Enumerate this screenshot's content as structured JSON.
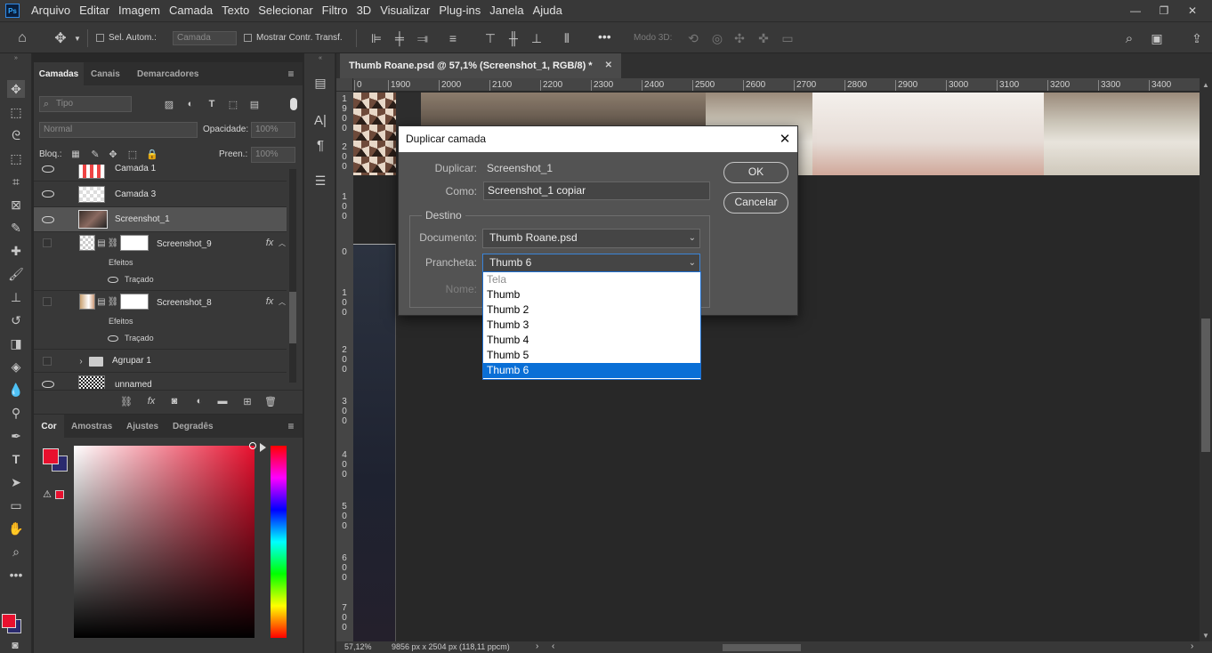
{
  "app": {
    "logo": "Ps"
  },
  "menu": [
    "Arquivo",
    "Editar",
    "Imagem",
    "Camada",
    "Texto",
    "Selecionar",
    "Filtro",
    "3D",
    "Visualizar",
    "Plug-ins",
    "Janela",
    "Ajuda"
  ],
  "window_controls": {
    "minimize": "—",
    "restore": "❐",
    "close": "✕"
  },
  "options": {
    "auto_select": "Sel. Autom.:",
    "auto_select_target": "Camada",
    "show_transform": "Mostrar Contr. Transf.",
    "more": "•••",
    "mode_3d": "Modo 3D:"
  },
  "layers_panel": {
    "tabs": [
      "Camadas",
      "Canais",
      "Demarcadores"
    ],
    "filter_placeholder": "Tipo",
    "blend_mode": "Normal",
    "opacity_label": "Opacidade:",
    "opacity": "100%",
    "lock_label": "Bloq.:",
    "fill_label": "Preen.:",
    "fill": "100%",
    "layers": [
      {
        "name": "Camada 1",
        "visible": true
      },
      {
        "name": "Camada 3",
        "visible": true
      },
      {
        "name": "Screenshot_1",
        "visible": true,
        "selected": true
      },
      {
        "name": "Screenshot_9",
        "visible": false,
        "effects": "Efeitos",
        "effect": "Traçado"
      },
      {
        "name": "Screenshot_8",
        "visible": false,
        "effects": "Efeitos",
        "effect": "Traçado"
      },
      {
        "name": "Agrupar 1",
        "visible": false,
        "group": true
      },
      {
        "name": "unnamed",
        "visible": true
      }
    ]
  },
  "color_panel": {
    "tabs": [
      "Cor",
      "Amostras",
      "Ajustes",
      "Degradês"
    ],
    "foreground": "#e8102e",
    "background": "#2a2a6e"
  },
  "document": {
    "tab_title": "Thumb Roane.psd @ 57,1% (Screenshot_1, RGB/8) *",
    "ruler_h": [
      "0",
      "1900",
      "2000",
      "2100",
      "2200",
      "2300",
      "2400",
      "2500",
      "2600",
      "2700",
      "2800",
      "2900",
      "3000",
      "3100",
      "3200",
      "3300",
      "3400"
    ],
    "ruler_v": [
      "1 9 0 0",
      "2 0 0",
      "1 0 0",
      "0",
      "1 0 0",
      "2 0 0",
      "3 0 0",
      "4 0 0",
      "5 0 0",
      "6 0 0",
      "7 0 0"
    ],
    "zoom": "57,12%",
    "doc_info": "9856 px x 2504 px (118,11 ppcm)"
  },
  "dialog": {
    "title": "Duplicar camada",
    "duplicate_label": "Duplicar:",
    "duplicate_value": "Screenshot_1",
    "as_label": "Como:",
    "as_value": "Screenshot_1 copiar",
    "destination_label": "Destino",
    "document_label": "Documento:",
    "document_value": "Thumb Roane.psd",
    "artboard_label": "Prancheta:",
    "artboard_value": "Thumb 6",
    "name_label": "Nome:",
    "ok": "OK",
    "cancel": "Cancelar",
    "artboard_options": [
      "Tela",
      "Thumb",
      "Thumb 2",
      "Thumb 3",
      "Thumb 4",
      "Thumb 5",
      "Thumb 6"
    ]
  }
}
